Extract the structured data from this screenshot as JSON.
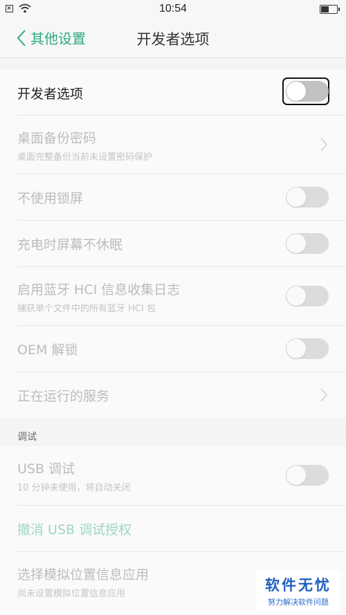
{
  "statusbar": {
    "time": "10:54",
    "battery_level": 0.5
  },
  "navbar": {
    "back_label": "其他设置",
    "title": "开发者选项"
  },
  "main_switch": {
    "label": "开发者选项",
    "on": false
  },
  "settings": {
    "backup_password": {
      "title": "桌面备份密码",
      "subtitle": "桌面完整备份当前未设置密码保护"
    },
    "stay_awake_lock": {
      "title": "不使用锁屏"
    },
    "charging_awake": {
      "title": "充电时屏幕不休眠"
    },
    "bt_hci_log": {
      "title": "启用蓝牙 HCI 信息收集日志",
      "subtitle": "捕获单个文件中的所有蓝牙 HCI 包"
    },
    "oem_unlock": {
      "title": "OEM 解锁"
    },
    "running_services": {
      "title": "正在运行的服务"
    }
  },
  "debug_section": {
    "header": "调试",
    "usb_debug": {
      "title": "USB 调试",
      "subtitle": "10 分钟未使用，将自动关闭"
    },
    "revoke_usb": {
      "title": "撤消 USB 调试授权"
    },
    "mock_location": {
      "title": "选择模拟位置信息应用",
      "subtitle": "尚未设置模拟位置信息应用"
    }
  },
  "watermark": {
    "title": "软件无忧",
    "subtitle": "努力解决软件问题"
  },
  "colors": {
    "accent": "#2eaa7e",
    "disabled_text": "#bcbcbc",
    "toggle_off": "#dcdcdc"
  }
}
